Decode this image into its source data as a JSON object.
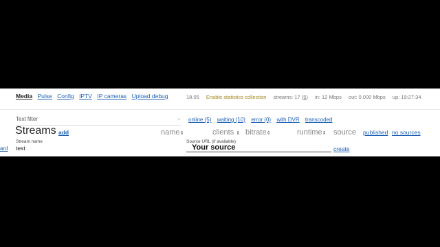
{
  "nav": {
    "items": [
      {
        "label": "Media",
        "active": true
      },
      {
        "label": "Pulse",
        "active": false
      },
      {
        "label": "Config",
        "active": false
      },
      {
        "label": "IPTV",
        "active": false
      },
      {
        "label": "IP cameras",
        "active": false
      },
      {
        "label": "Upload debug",
        "active": false
      }
    ]
  },
  "status": {
    "version": "18.05",
    "stats_link": "Enable statistics collection",
    "streams_label": "streams: 17 (",
    "streams_count": "5",
    "streams_close": ")",
    "in": "in: 12 Mbps",
    "out": "out: 0.000 Mbps",
    "uptime": "up: 19:27:34"
  },
  "filter": {
    "label": "Text filter",
    "online": "online (5)",
    "waiting": "waiting (10)",
    "error": "error (0)",
    "dvr": "with DVR",
    "transcoded": "transcoded"
  },
  "streams": {
    "title": "Streams",
    "add_label": "add",
    "columns": {
      "name": "name",
      "clients": "clients",
      "bitrate": "bitrate",
      "runtime": "runtime",
      "source": "source"
    },
    "sort_glyph": "⇕",
    "published": "published",
    "no_sources": "no sources"
  },
  "new_stream": {
    "name_label": "Stream name",
    "name_value": "test",
    "source_label": "Source URL (if available)",
    "source_placeholder": "Your source",
    "create_label": "create",
    "left_cut_label": "ard"
  },
  "colors": {
    "link": "#1a5fb4",
    "stats_link": "#a0851e"
  }
}
